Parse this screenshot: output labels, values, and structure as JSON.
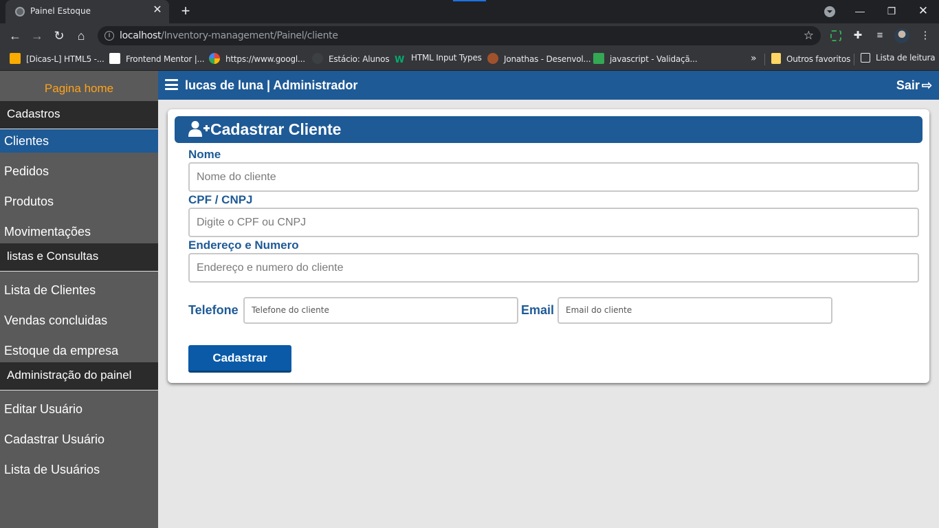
{
  "browser": {
    "tab_title": "Painel Estoque",
    "url_host": "localhost",
    "url_path": "/Inventory-management/Painel/cliente",
    "bookmarks": [
      {
        "label": "[Dicas-L] HTML5 -...",
        "icon": "dicas-l-icon",
        "color": "#f9ab00"
      },
      {
        "label": "Frontend Mentor |...",
        "icon": "frontend-mentor-icon",
        "color": "#ffffff"
      },
      {
        "label": "https://www.googl...",
        "icon": "google-icon",
        "color": "#ffffff"
      },
      {
        "label": "Estácio: Alunos",
        "icon": "estacio-icon",
        "color": "#3c4043"
      },
      {
        "label": "HTML Input Types",
        "icon": "w3schools-icon",
        "color": "#04aa6d"
      },
      {
        "label": "Jonathas - Desenvol...",
        "icon": "avatar-icon",
        "color": "#a0522d"
      },
      {
        "label": "javascript - Validaçã...",
        "icon": "stackoverflow-icon",
        "color": "#34a853"
      }
    ],
    "other_bookmarks": "Outros favoritos",
    "reading_list": "Lista de leitura"
  },
  "sidebar": {
    "home": "Pagina home",
    "sections": [
      {
        "title": "Cadastros",
        "items": [
          "Clientes",
          "Pedidos",
          "Produtos",
          "Movimentações"
        ]
      },
      {
        "title": "listas e Consultas",
        "items": [
          "Lista de Clientes",
          "Vendas concluidas",
          "Estoque da empresa"
        ]
      },
      {
        "title": "Administração do painel",
        "items": [
          "Editar Usuário",
          "Cadastrar Usuário",
          "Lista de Usuários"
        ]
      }
    ],
    "active_item": "Clientes"
  },
  "topbar": {
    "user_title": "lucas de luna | Administrador",
    "logout": "Sair"
  },
  "form": {
    "title": "Cadastrar Cliente",
    "name_label": "Nome",
    "name_placeholder": "Nome do cliente",
    "doc_label": "CPF / CNPJ",
    "doc_placeholder": "Digite o CPF ou CNPJ",
    "address_label": "Endereço e Numero",
    "address_placeholder": "Endereço e numero do cliente",
    "phone_label": "Telefone",
    "phone_placeholder": "Telefone do cliente",
    "email_label": "Email",
    "email_placeholder": "Email do cliente",
    "submit": "Cadastrar"
  },
  "colors": {
    "primary": "#1e5a96",
    "accent": "#ffa31a",
    "sidebar": "#5a5a5a",
    "section": "#2b2b2b"
  }
}
